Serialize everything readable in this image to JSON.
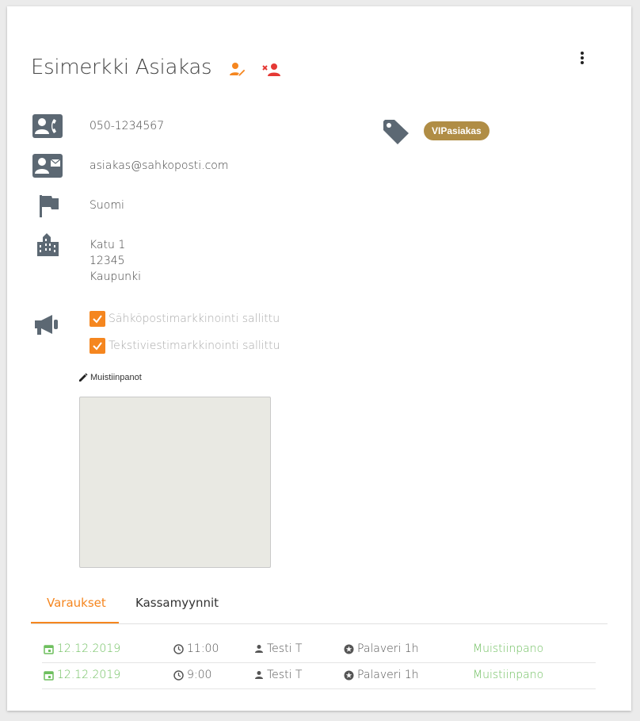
{
  "customer": {
    "name": "Esimerkki Asiakas",
    "phone": "050-1234567",
    "email": "asiakas@sahkoposti.com",
    "country": "Suomi",
    "address": {
      "street": "Katu 1",
      "postal_code": "12345",
      "city": "Kaupunki"
    }
  },
  "tags": [
    {
      "label": "VIPasiakas",
      "color": "#b08d45"
    }
  ],
  "marketing": {
    "email_label": "Sähköpostimarkkinointi sallittu",
    "email_checked": true,
    "sms_label": "Tekstiviestimarkkinointi sallittu",
    "sms_checked": true
  },
  "notes": {
    "label": "Muistiinpanot",
    "value": ""
  },
  "tabs": [
    {
      "label": "Varaukset",
      "active": true
    },
    {
      "label": "Kassamyynnit",
      "active": false
    }
  ],
  "reservations": [
    {
      "date": "12.12.2019",
      "time": "11:00",
      "person": "Testi T",
      "service": "Palaveri 1h",
      "note_link": "Muistiinpano"
    },
    {
      "date": "12.12.2019",
      "time": "9:00",
      "person": "Testi T",
      "service": "Palaveri 1h",
      "note_link": "Muistiinpano"
    }
  ],
  "colors": {
    "accent": "#f5861f",
    "delete": "#e53935",
    "icon_gray": "#5c6873",
    "link_green": "#6ebf5e"
  },
  "icons": {
    "edit": "edit-user-icon",
    "delete": "remove-user-icon",
    "menu": "more-vert-icon",
    "phone": "contact-phone-icon",
    "email": "contact-mail-icon",
    "country": "flag-icon",
    "address": "building-icon",
    "marketing": "megaphone-icon",
    "tag": "tag-icon"
  }
}
